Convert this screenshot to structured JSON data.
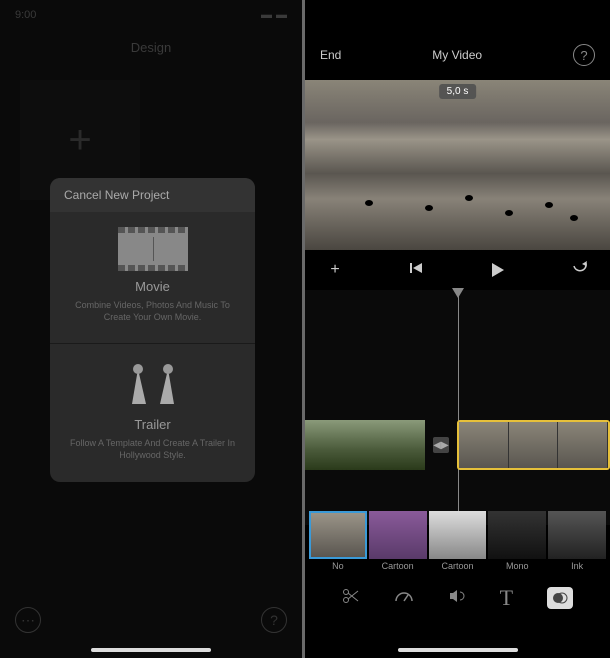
{
  "left": {
    "header": "Design",
    "plus_icon": "+",
    "modal": {
      "header": "Cancel New Project",
      "movie": {
        "title": "Movie",
        "desc": "Combine Videos, Photos And Music To Create Your Own Movie."
      },
      "trailer": {
        "title": "Trailer",
        "desc": "Follow A Template And Create A Trailer In Hollywood Style."
      }
    },
    "more_icon": "⋯",
    "help_icon": "?"
  },
  "right": {
    "nav": {
      "done": "End",
      "title": "My Video",
      "help": "?"
    },
    "preview": {
      "time_badge": "5,0 s"
    },
    "transport": {
      "add": "+",
      "prev": "|◀",
      "play": "▶",
      "undo": "↶"
    },
    "transition": "◀▶",
    "filters": [
      {
        "label": "No"
      },
      {
        "label": "Cartoon"
      },
      {
        "label": "Cartoon"
      },
      {
        "label": "Mono"
      },
      {
        "label": "Ink"
      }
    ],
    "tools": {
      "cut": "✂",
      "speed": "⏱",
      "audio": "🔊",
      "text": "T",
      "filter": "◐"
    }
  }
}
